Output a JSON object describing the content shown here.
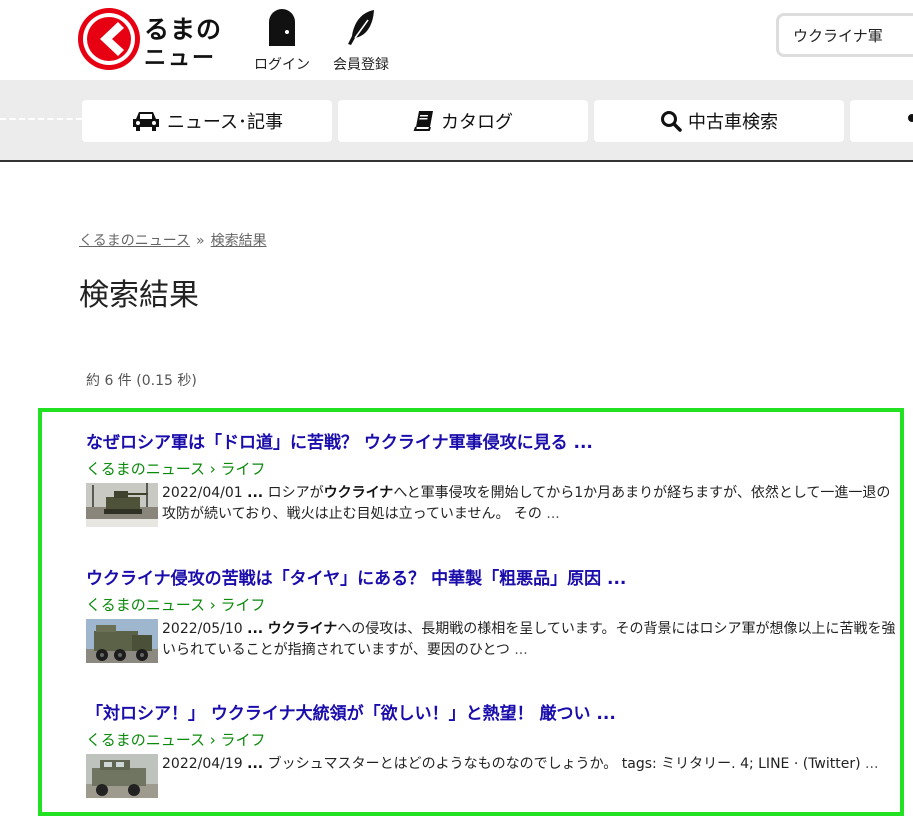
{
  "header": {
    "logo": {
      "line1": "るまの",
      "line2": "ニュース"
    },
    "login_label": "ログイン",
    "register_label": "会員登録",
    "search": {
      "value": "ウクライナ軍",
      "placeholder": ""
    }
  },
  "nav": {
    "items": [
      {
        "label": "ニュース･記事",
        "icon": "car-icon"
      },
      {
        "label": "カタログ",
        "icon": "book-icon"
      },
      {
        "label": "中古車検索",
        "icon": "search-icon"
      }
    ]
  },
  "breadcrumb": {
    "home": "くるまのニュース",
    "separator": "»",
    "current": "検索結果"
  },
  "page_title": "検索結果",
  "result_count": "約 6 件 (0.15 秒)",
  "results": [
    {
      "title": "なぜロシア軍は「ドロ道」に苦戦？ ウクライナ軍事侵攻に見る ...",
      "url": "くるまのニュース › ライフ",
      "date": "2022/04/01",
      "ellipsis": "...",
      "pre": "ロシアが",
      "keyword": "ウクライナ",
      "post": "へと軍事侵攻を開始してから1か月あまりが経ちますが、依然として一進一退の攻防が続いており、戦火は止む目処は立っていません。 その",
      "trail": "..."
    },
    {
      "title": "ウクライナ侵攻の苦戦は「タイヤ」にある？ 中華製「粗悪品」原因 ...",
      "url": "くるまのニュース › ライフ",
      "date": "2022/05/10",
      "ellipsis": "...",
      "pre": "",
      "keyword": "ウクライナ",
      "post": "への侵攻は、長期戦の様相を呈しています。その背景にはロシア軍が想像以上に苦戦を強いられていることが指摘されていますが、要因のひとつ",
      "trail": "..."
    },
    {
      "title": "「対ロシア！」 ウクライナ大統領が「欲しい！」と熱望！ 厳つい ...",
      "url": "くるまのニュース › ライフ",
      "date": "2022/04/19",
      "ellipsis": "...",
      "pre": "ブッシュマスターとはどのようなものなのでしょうか。 tags: ミリタリー. 4; LINE · (Twitter)",
      "keyword": "",
      "post": "",
      "trail": "..."
    }
  ],
  "colors": {
    "brand_red": "#e60012",
    "link_blue": "#1a0dab",
    "url_green": "#0a8a0a",
    "highlight_border": "#22e022"
  }
}
